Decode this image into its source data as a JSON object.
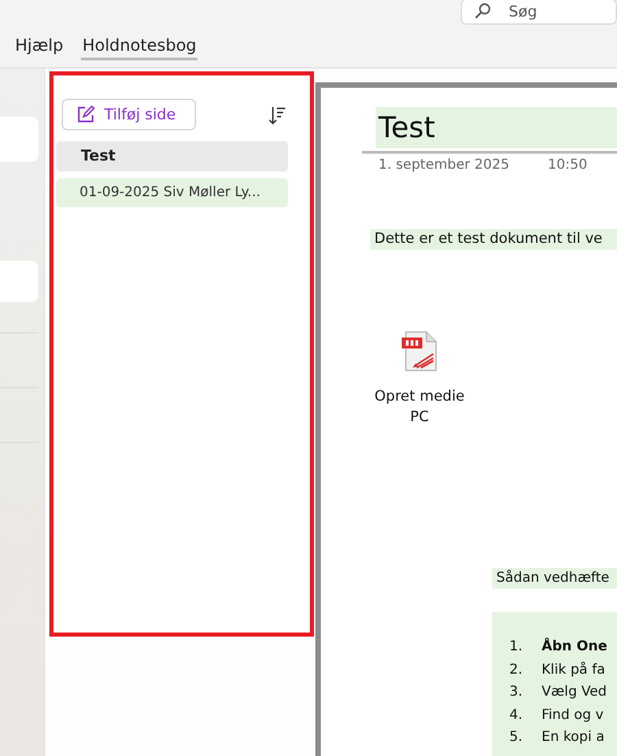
{
  "search": {
    "placeholder": "Søg"
  },
  "menu": [
    {
      "label": "Hjælp",
      "selected": false
    },
    {
      "label": "Holdnotesbog",
      "selected": true
    }
  ],
  "page_list": {
    "add_button": "Tilføj side",
    "sections": [
      {
        "title": "Test",
        "pages": [
          {
            "title": "01-09-2025 Siv Møller Ly...",
            "selected": true
          }
        ]
      }
    ]
  },
  "note": {
    "title": "Test",
    "date": "1. september 2025",
    "time": "10:50",
    "intro": "Dette er et test dokument til ve",
    "attachment": {
      "label": "Opret medie PC"
    },
    "heading": "Sådan vedhæfte",
    "steps": [
      {
        "number": "1.",
        "text": "Åbn One",
        "bold": true
      },
      {
        "number": "2.",
        "text": "Klik på fa",
        "bold": false
      },
      {
        "number": "3.",
        "text": "Vælg Ved",
        "bold": false
      },
      {
        "number": "4.",
        "text": "Find og v",
        "bold": false
      },
      {
        "number": "5.",
        "text": "En kopi a",
        "bold": false
      }
    ]
  }
}
